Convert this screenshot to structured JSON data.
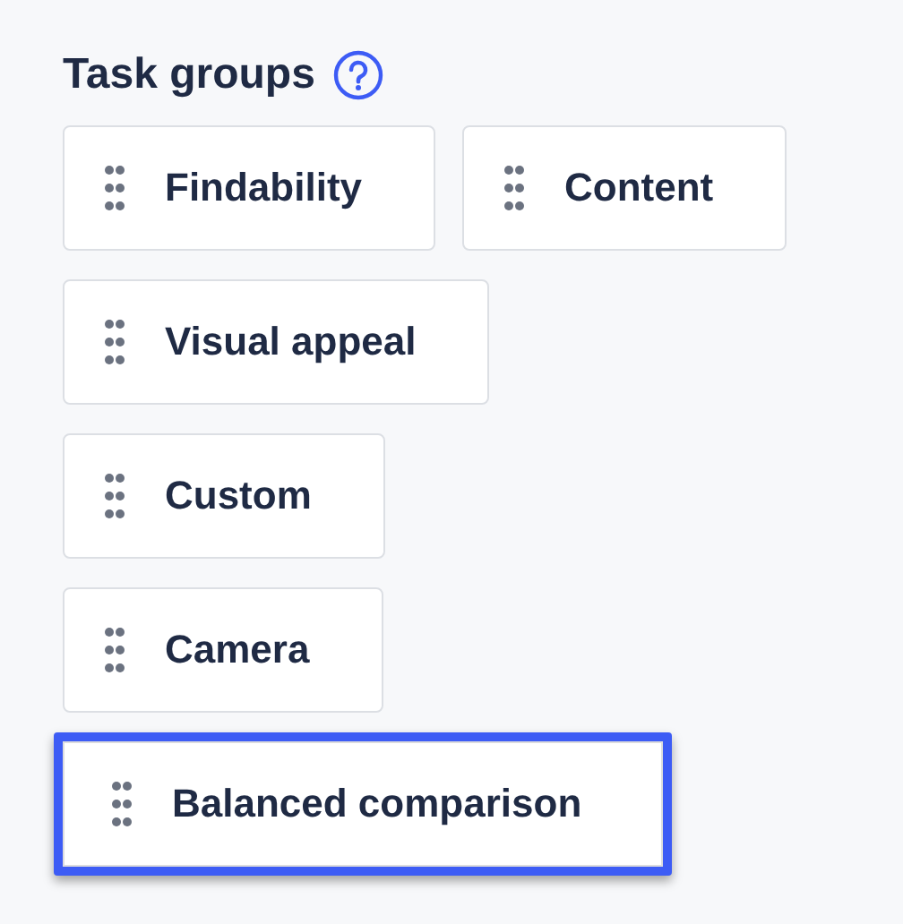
{
  "title": "Task groups",
  "rows": [
    [
      {
        "label": "Findability",
        "selected": false
      },
      {
        "label": "Content",
        "selected": false
      }
    ],
    [
      {
        "label": "Visual appeal",
        "selected": false
      }
    ],
    [
      {
        "label": "Custom",
        "selected": false
      }
    ],
    [
      {
        "label": "Camera",
        "selected": false
      }
    ],
    [
      {
        "label": "Balanced comparison",
        "selected": true
      }
    ]
  ]
}
